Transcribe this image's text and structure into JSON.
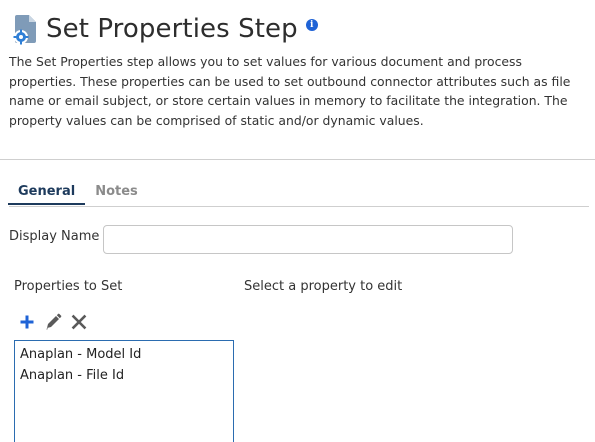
{
  "header": {
    "title": "Set Properties Step",
    "icon": "document-gear-icon",
    "info_icon": "info-icon",
    "info_glyph": "i"
  },
  "description": "The Set Properties step allows you to set values for various document and process properties. These properties can be used to set outbound connector attributes such as file name or email subject, or store certain values in memory to facilitate the integration. The property values can be comprised of static and/or dynamic values.",
  "tabs": [
    {
      "label": "General",
      "active": true
    },
    {
      "label": "Notes",
      "active": false
    }
  ],
  "form": {
    "display_name_label": "Display Name",
    "display_name_value": ""
  },
  "properties": {
    "label": "Properties to Set",
    "edit_hint": "Select a property to edit",
    "toolbar": {
      "add_icon": "plus-icon",
      "edit_icon": "pencil-icon",
      "delete_icon": "x-icon"
    },
    "items": [
      {
        "label": "Anaplan - Model Id"
      },
      {
        "label": "Anaplan - File Id"
      }
    ]
  },
  "colors": {
    "accent": "#1f63d6",
    "tab_active": "#1d3a5c",
    "list_border": "#2b6cb0",
    "icon_gray": "#5a5a5a"
  }
}
